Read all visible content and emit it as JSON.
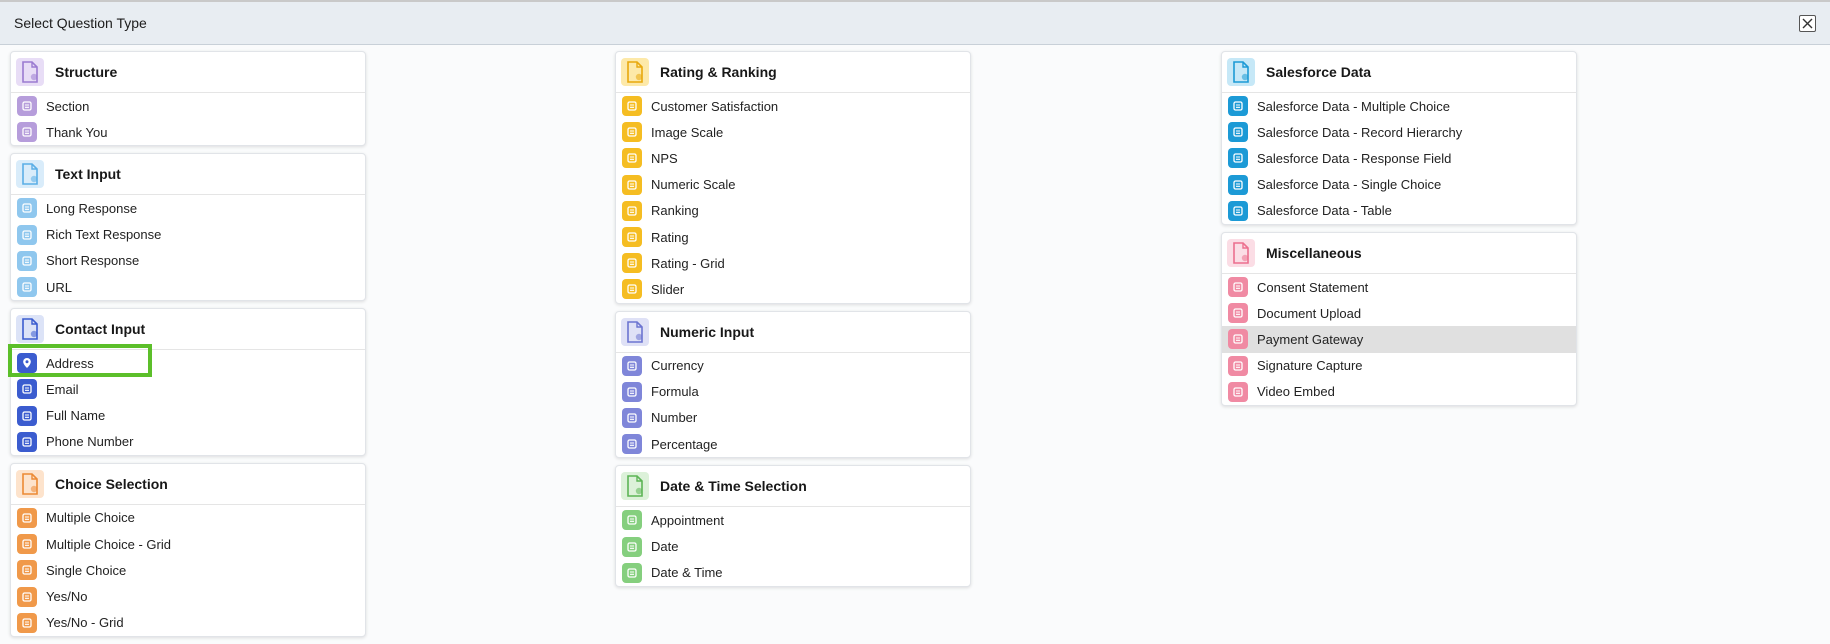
{
  "dialog": {
    "title": "Select Question Type",
    "close_label": "close"
  },
  "columns": [
    [
      {
        "title": "Structure",
        "color": "purple",
        "items": [
          "Section",
          "Thank You"
        ]
      },
      {
        "title": "Text Input",
        "color": "lightblue",
        "items": [
          "Long Response",
          "Rich Text Response",
          "Short Response",
          "URL"
        ]
      },
      {
        "title": "Contact Input",
        "color": "blue",
        "items": [
          "Address",
          "Email",
          "Full Name",
          "Phone Number"
        ]
      },
      {
        "title": "Choice Selection",
        "color": "orange",
        "items": [
          "Multiple Choice",
          "Multiple Choice - Grid",
          "Single Choice",
          "Yes/No",
          "Yes/No - Grid"
        ]
      }
    ],
    [
      {
        "title": "Rating & Ranking",
        "color": "yellow",
        "items": [
          "Customer Satisfaction",
          "Image Scale",
          "NPS",
          "Numeric Scale",
          "Ranking",
          "Rating",
          "Rating - Grid",
          "Slider"
        ]
      },
      {
        "title": "Numeric Input",
        "color": "indigo",
        "items": [
          "Currency",
          "Formula",
          "Number",
          "Percentage"
        ]
      },
      {
        "title": "Date & Time Selection",
        "color": "green",
        "items": [
          "Appointment",
          "Date",
          "Date & Time"
        ]
      }
    ],
    [
      {
        "title": "Salesforce Data",
        "color": "cyan",
        "items": [
          "Salesforce Data - Multiple Choice",
          "Salesforce Data - Record Hierarchy",
          "Salesforce Data - Response Field",
          "Salesforce Data - Single Choice",
          "Salesforce Data - Table"
        ]
      },
      {
        "title": "Miscellaneous",
        "color": "pink",
        "items": [
          "Consent Statement",
          "Document Upload",
          "Payment Gateway",
          "Signature Capture",
          "Video Embed"
        ]
      }
    ]
  ],
  "hovered_item": "Payment Gateway",
  "highlighted_item": "Address"
}
